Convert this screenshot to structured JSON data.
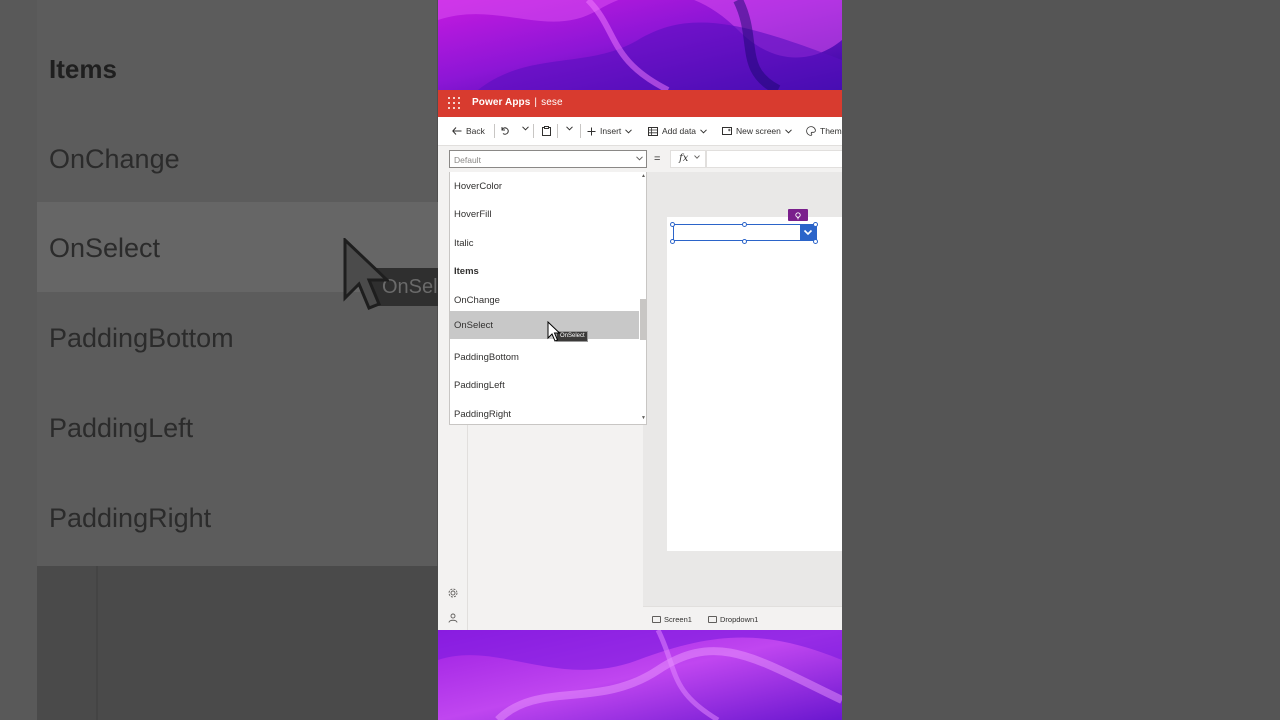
{
  "background_zoom": {
    "items": [
      "Items",
      "OnChange",
      "OnSelect",
      "PaddingBottom",
      "PaddingLeft",
      "PaddingRight"
    ],
    "tooltip_fragment": "OnSel"
  },
  "header": {
    "product": "Power Apps",
    "separator": "|",
    "app_name": "sese"
  },
  "toolbar": {
    "back_label": "Back",
    "insert_label": "Insert",
    "add_data_label": "Add data",
    "new_screen_label": "New screen",
    "theme_label": "Them"
  },
  "formula_bar": {
    "property_placeholder": "Default",
    "equals": "=",
    "fx": "fx",
    "formula": ""
  },
  "property_list": {
    "items": [
      {
        "label": "HoverColor",
        "bold": false,
        "selected": false
      },
      {
        "label": "HoverFill",
        "bold": false,
        "selected": false
      },
      {
        "label": "Italic",
        "bold": false,
        "selected": false
      },
      {
        "label": "Items",
        "bold": true,
        "selected": false
      },
      {
        "label": "OnChange",
        "bold": false,
        "selected": false
      },
      {
        "label": "OnSelect",
        "bold": false,
        "selected": true
      },
      {
        "label": "PaddingBottom",
        "bold": false,
        "selected": false
      },
      {
        "label": "PaddingLeft",
        "bold": false,
        "selected": false
      },
      {
        "label": "PaddingRight",
        "bold": false,
        "selected": false
      }
    ],
    "tooltip": "OnSelect"
  },
  "statusbar": {
    "screen": "Screen1",
    "control": "Dropdown1"
  },
  "colors": {
    "header": "#d83b2f",
    "selection": "#2b64c9",
    "badge": "#7a1f8c"
  }
}
